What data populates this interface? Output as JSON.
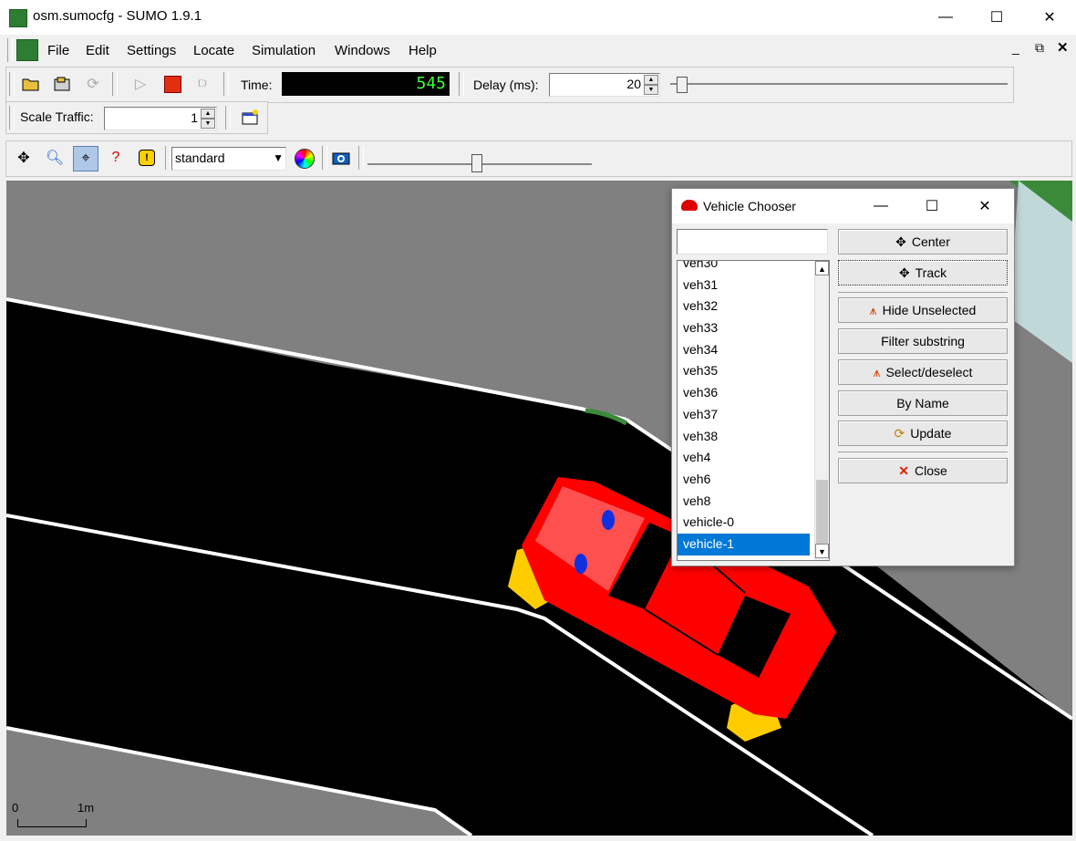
{
  "window": {
    "title": "osm.sumocfg - SUMO 1.9.1"
  },
  "menu": [
    "File",
    "Edit",
    "Settings",
    "Locate",
    "Simulation",
    "Windows",
    "Help"
  ],
  "toolbar": {
    "time_label": "Time:",
    "time_value": "545",
    "delay_label": "Delay (ms):",
    "delay_value": "20",
    "scale_label": "Scale Traffic:",
    "scale_value": "1"
  },
  "view_toolbar": {
    "scheme_value": "standard"
  },
  "scale_bar": {
    "zero": "0",
    "one": "1m"
  },
  "dialog": {
    "title": "Vehicle Chooser",
    "filter_value": "",
    "items": [
      "veh30",
      "veh31",
      "veh32",
      "veh33",
      "veh34",
      "veh35",
      "veh36",
      "veh37",
      "veh38",
      "veh4",
      "veh6",
      "veh8",
      "vehicle-0",
      "vehicle-1"
    ],
    "selected": "vehicle-1",
    "buttons": {
      "center": "Center",
      "track": "Track",
      "hide_unselected": "Hide Unselected",
      "filter_substring": "Filter substring",
      "select_deselect": "Select/deselect",
      "by_name": "By Name",
      "update": "Update",
      "close": "Close"
    }
  },
  "colors": {
    "selection": "#0078d7",
    "road": "#000000",
    "sidewalk": "#808080",
    "grass": "#3c8c3c",
    "vehicle": "#ff0000"
  }
}
